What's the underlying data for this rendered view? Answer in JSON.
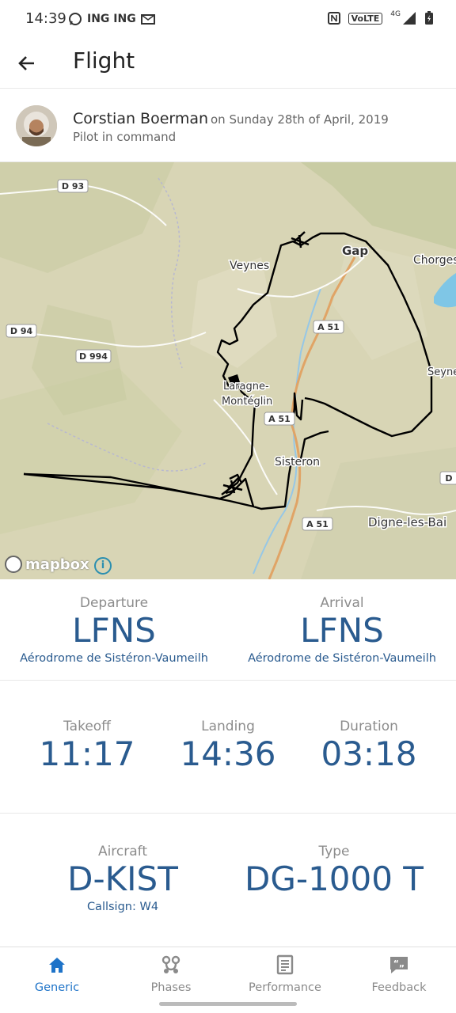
{
  "status_bar": {
    "time": "14:39",
    "notifications": "ING ING",
    "network": "4G",
    "volte": "VoLTE"
  },
  "app_bar": {
    "title": "Flight"
  },
  "pilot": {
    "name": "Corstian Boerman",
    "date": "on Sunday 28th of April, 2019",
    "role": "Pilot in command"
  },
  "map": {
    "labels": {
      "d93": "D 93",
      "d94": "D 94",
      "d994": "D 994",
      "a51_1": "A 51",
      "a51_2": "A 51",
      "a51_3": "A 51",
      "d_right": "D",
      "veynes": "Veynes",
      "gap": "Gap",
      "chorges": "Chorges",
      "seyne": "Seyne",
      "laragne1": "Laragne-",
      "laragne2": "Montéglin",
      "sisteron": "Sisteron",
      "digne": "Digne-les-Bai"
    },
    "attribution": "mapbox",
    "info": "i",
    "colors": {
      "land": "#d9d6b6",
      "track": "#000000",
      "water": "#7fc6e6"
    }
  },
  "airports": {
    "departure_label": "Departure",
    "departure_code": "LFNS",
    "departure_name": "Aérodrome de Sistéron-Vaumeilh",
    "arrival_label": "Arrival",
    "arrival_code": "LFNS",
    "arrival_name": "Aérodrome de Sistéron-Vaumeilh"
  },
  "times": {
    "takeoff_label": "Takeoff",
    "takeoff": "11:17",
    "landing_label": "Landing",
    "landing": "14:36",
    "duration_label": "Duration",
    "duration": "03:18"
  },
  "aircraft": {
    "aircraft_label": "Aircraft",
    "registration": "D-KIST",
    "callsign": "Callsign: W4",
    "type_label": "Type",
    "type": "DG-1000 T"
  },
  "bottom_nav": {
    "items": [
      {
        "label": "Generic",
        "icon": "home-icon",
        "active": true
      },
      {
        "label": "Phases",
        "icon": "phases-icon",
        "active": false
      },
      {
        "label": "Performance",
        "icon": "performance-icon",
        "active": false
      },
      {
        "label": "Feedback",
        "icon": "feedback-icon",
        "active": false
      }
    ],
    "active_color": "#1e73c8"
  }
}
